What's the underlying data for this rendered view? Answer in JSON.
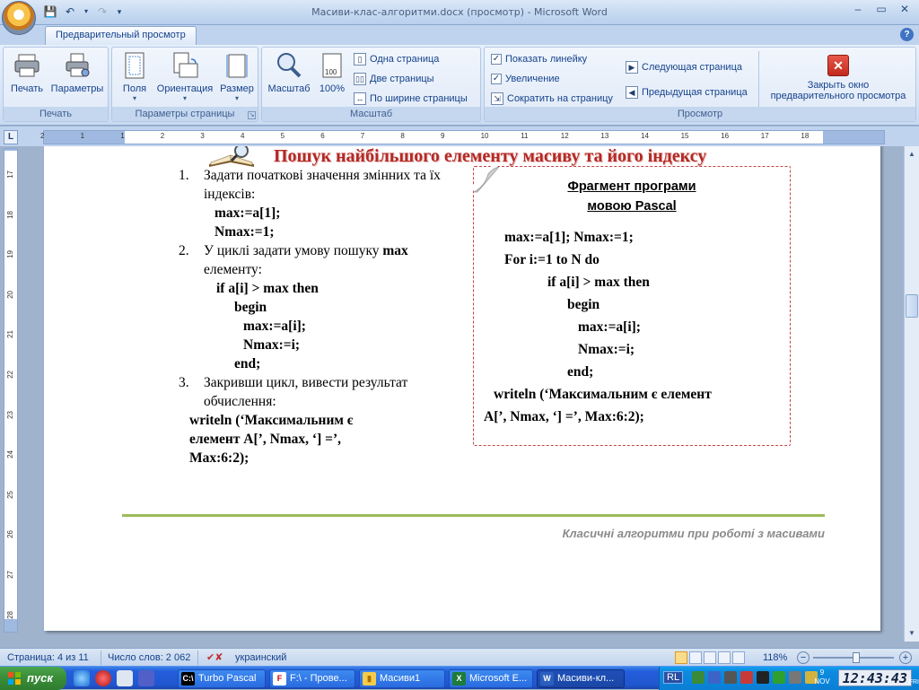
{
  "window": {
    "title": "Масиви-клас-алгоритми.docx (просмотр) - Microsoft Word",
    "min": "–",
    "max": "▭",
    "close": "✕"
  },
  "tab": {
    "active": "Предварительный просмотр"
  },
  "ribbon": {
    "print_group": {
      "label": "Печать",
      "print": "Печать",
      "params": "Параметры"
    },
    "page_setup": {
      "label": "Параметры страницы",
      "fields": "Поля",
      "orientation": "Ориентация",
      "size": "Размер"
    },
    "zoom": {
      "label": "Масштаб",
      "zoom": "Масштаб",
      "hundred": "100%",
      "one_page": "Одна страница",
      "two_pages": "Две страницы",
      "page_width": "По ширине страницы"
    },
    "preview": {
      "label": "Просмотр",
      "show_ruler": "Показать линейку",
      "magnifier": "Увеличение",
      "shrink": "Сократить на страницу",
      "next_page": "Следующая страница",
      "prev_page": "Предыдущая страница",
      "show_ruler_checked": true,
      "magnifier_checked": true
    },
    "close": {
      "line1": "Закрыть окно",
      "line2": "предварительного просмотра"
    }
  },
  "ruler": {
    "h_ticks": [
      "2",
      "1",
      "1",
      "2",
      "3",
      "4",
      "5",
      "6",
      "7",
      "8",
      "9",
      "10",
      "11",
      "12",
      "13",
      "14",
      "15",
      "16",
      "17",
      "18"
    ],
    "v_ticks": [
      "17",
      "18",
      "19",
      "20",
      "21",
      "22",
      "23",
      "24",
      "25",
      "26",
      "27",
      "28"
    ]
  },
  "slide": {
    "title": "Пошук найбільшого елементу масиву та його індексу",
    "steps": [
      {
        "num": "1.",
        "lines": [
          "Задати початкові значення змінних та їх індексів:"
        ],
        "code": [
          "max:=a[1];",
          "Nmax:=1;"
        ]
      },
      {
        "num": "2.",
        "lines_pre": "У циклі задати умову пошуку",
        "bold": "max",
        "lines_post": "елементу:",
        "code": [
          "if a[i] > max then",
          "begin",
          "max:=a[i];",
          "Nmax:=i;",
          "end;"
        ]
      },
      {
        "num": "3.",
        "lines": [
          "Закривши цикл, вивести результат обчислення:"
        ],
        "code": [
          "writeln (‘Максимальним є",
          "елемент  A[’, Nmax, ‘] =’,",
          "Max:6:2);"
        ]
      }
    ],
    "box": {
      "title_line1": "Фрагмент програми",
      "title_line2": "мовою Pascal",
      "code": [
        "max:=a[1]; Nmax:=1;",
        "For i:=1 to N do",
        "if a[i] > max then",
        "begin",
        "max:=a[i];",
        "Nmax:=i;",
        "end;",
        "writeln (‘Максимальним є елемент",
        "A[’, Nmax, ‘] =’, Max:6:2);"
      ]
    },
    "footer": "Класичні алгоритми при  роботі з масивами"
  },
  "status": {
    "page": "Страница: 4 из 11",
    "words": "Число слов: 2 062",
    "lang": "украинский",
    "zoom": "118%",
    "zoom_minus": "−",
    "zoom_plus": "+"
  },
  "taskbar": {
    "start": "пуск",
    "items": [
      {
        "label": "Turbo Pascal",
        "icon": "C:\\"
      },
      {
        "label": "F:\\ - Прове...",
        "icon": "F"
      },
      {
        "label": "Масиви1",
        "icon": "▮"
      },
      {
        "label": "Microsoft E...",
        "icon": "X"
      },
      {
        "label": "Масиви-кл...",
        "icon": "W"
      }
    ],
    "lang": "RL",
    "date_day": "9",
    "date_month": "NOV",
    "date_dow": "FRI",
    "clock": "12:43:43"
  },
  "colors": {
    "title_red": "#b32a26",
    "footer_green": "#9bbb59",
    "ribbon_blue": "#15428b"
  }
}
